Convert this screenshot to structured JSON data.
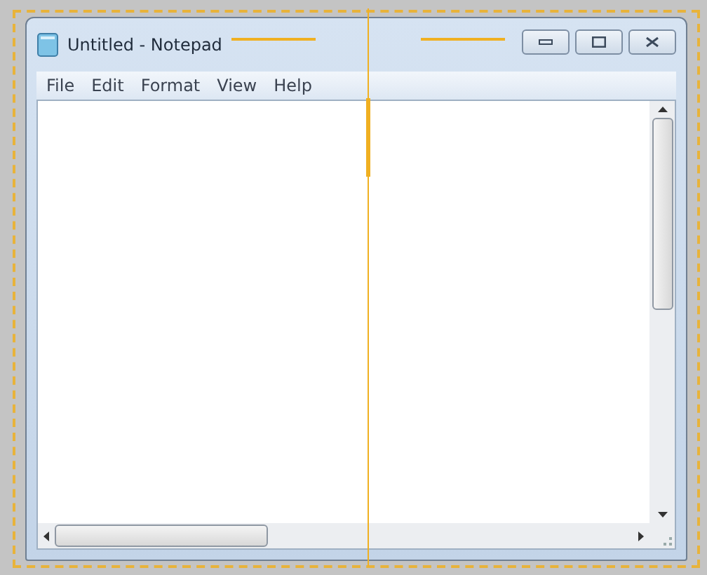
{
  "window": {
    "title": "Untitled - Notepad"
  },
  "menu": [
    {
      "label": "File"
    },
    {
      "label": "Edit"
    },
    {
      "label": "Format"
    },
    {
      "label": "View"
    },
    {
      "label": "Help"
    }
  ]
}
